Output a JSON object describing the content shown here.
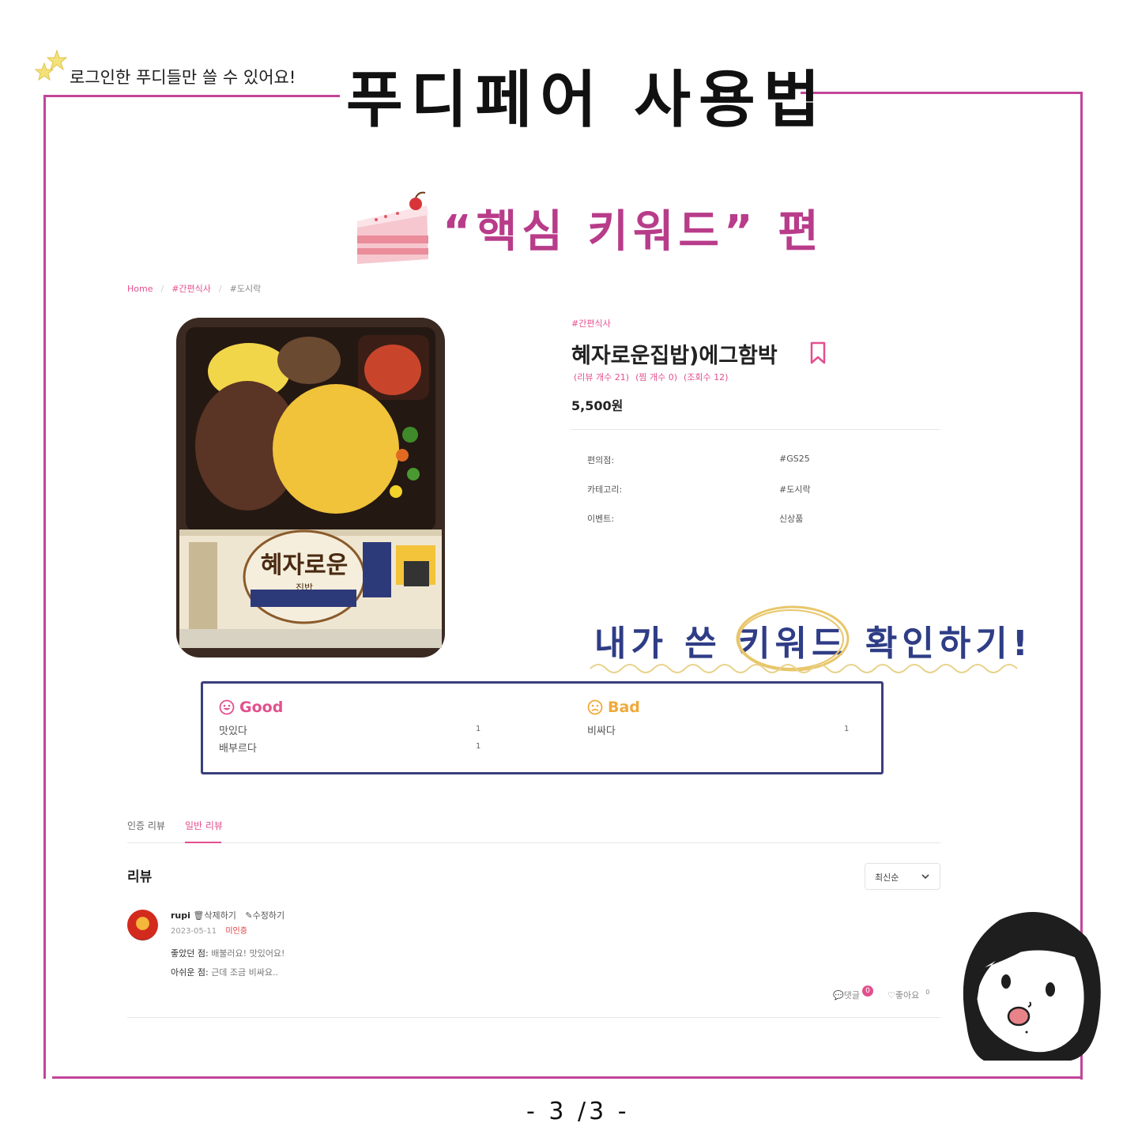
{
  "header": {
    "note": "로그인한 푸디들만 쓸 수 있어요!",
    "title": "푸디페어 사용법",
    "subtitle": "“핵심 키워드” 편"
  },
  "breadcrumb": [
    "Home",
    "#간편식사",
    "#도시락"
  ],
  "product": {
    "category_tag": "#간편식사",
    "title": "혜자로운집밥)에그함박",
    "review_count": "(리뷰 개수 21)",
    "like_count": "(찜 개수 0)",
    "view_count": "(조회수 12)",
    "price": "5,500원",
    "package_brand": "혜자로운",
    "package_sub": "집밥",
    "info": [
      {
        "label": "편의점:",
        "value": "#GS25"
      },
      {
        "label": "카테고리:",
        "value": "#도시락"
      },
      {
        "label": "이벤트:",
        "value": "신상품"
      }
    ]
  },
  "annotation": {
    "text": "내가 쓴 키워드 확인하기!"
  },
  "keywords": {
    "good_label": "Good",
    "bad_label": "Bad",
    "good": [
      {
        "word": "맛있다",
        "count": "1"
      },
      {
        "word": "배부르다",
        "count": "1"
      }
    ],
    "bad": [
      {
        "word": "비싸다",
        "count": "1"
      }
    ]
  },
  "tabs": [
    "인증 리뷰",
    "일반 리뷰"
  ],
  "reviews": {
    "heading": "리뷰",
    "sort": "최신순",
    "items": [
      {
        "user": "rupi",
        "delete": "삭제하기",
        "edit": "수정하기",
        "date": "2023-05-11",
        "status": "미인증",
        "good_label": "좋았던 점:",
        "good_text": "배불러요! 맛있어요!",
        "bad_label": "아쉬운 점:",
        "bad_text": "근데 조금 비싸요..",
        "comment_label": "댓글",
        "comment_count": "0",
        "like_label": "좋아요",
        "like_count": "0"
      }
    ]
  },
  "footer": {
    "page": "- 3 /3 -"
  },
  "colors": {
    "accent": "#e3508e",
    "frame": "#c2459a",
    "note": "#2f3d86",
    "bad": "#f0a93a"
  }
}
